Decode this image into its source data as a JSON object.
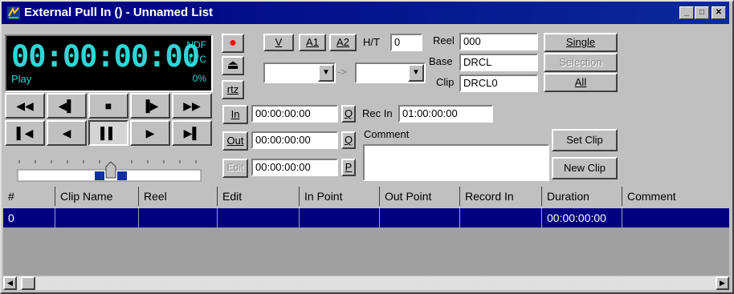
{
  "window": {
    "title": "External Pull In ()  - Unnamed List",
    "minimize_glyph": "_",
    "maximize_glyph": "□",
    "close_glyph": "✕"
  },
  "timecode": {
    "value": "00:00:00:00",
    "mode": "Play",
    "drop_frame": "NDF",
    "source": "LTC",
    "percent": "0%",
    "color": "#2fd6d6"
  },
  "transport": {
    "row1": [
      {
        "name": "rewind-button",
        "icon": "◀◀"
      },
      {
        "name": "step-back-button",
        "icon": "◀▌"
      },
      {
        "name": "stop-button",
        "icon": "■"
      },
      {
        "name": "step-forward-button",
        "icon": "▐▶"
      },
      {
        "name": "fast-forward-button",
        "icon": "▶▶"
      }
    ],
    "row2": [
      {
        "name": "go-to-start-button",
        "icon": "▌◀"
      },
      {
        "name": "play-reverse-button",
        "icon": "◀"
      },
      {
        "name": "pause-button",
        "icon": "▌▌"
      },
      {
        "name": "play-button",
        "icon": "▶"
      },
      {
        "name": "go-to-end-button",
        "icon": "▶▌"
      }
    ]
  },
  "controls": {
    "record_icon": "●",
    "eject_icon": "⏏",
    "rtz_label": "rtz",
    "v_label": "V",
    "a1_label": "A1",
    "a2_label": "A2",
    "ht_label": "H/T",
    "ht_value": "0",
    "reel_label": "Reel",
    "reel_value": "000",
    "base_label": "Base",
    "base_value": "DRCL",
    "clip_label": "Clip",
    "clip_value": "DRCL0",
    "single_label": "Single",
    "selection_label": "Selection",
    "all_label": "All",
    "arrow_label": "->",
    "dropdown_glyph": "▼",
    "in_label": "In",
    "in_value": "00:00:00:00",
    "q_label": "Q",
    "rec_in_label": "Rec In",
    "rec_in_value": "01:00:00:00",
    "out_label": "Out",
    "out_value": "00:00:00:00",
    "comment_label": "Comment",
    "comment_value": "",
    "edit_label": "Edit",
    "edit_value": "00:00:00:00",
    "p_label": "P",
    "set_clip_label": "Set Clip",
    "new_clip_label": "New Clip"
  },
  "grid": {
    "columns": [
      "#",
      "Clip Name",
      "Reel",
      "Edit",
      "In Point",
      "Out Point",
      "Record In",
      "Duration",
      "Comment"
    ],
    "rows": [
      [
        "0",
        "",
        "",
        "",
        "",
        "",
        "",
        "00:00:00:00",
        ""
      ]
    ]
  },
  "colors": {
    "titlebar": "#000080",
    "selection": "#000080",
    "record": "#ff0000",
    "face": "#c0c0c0"
  }
}
